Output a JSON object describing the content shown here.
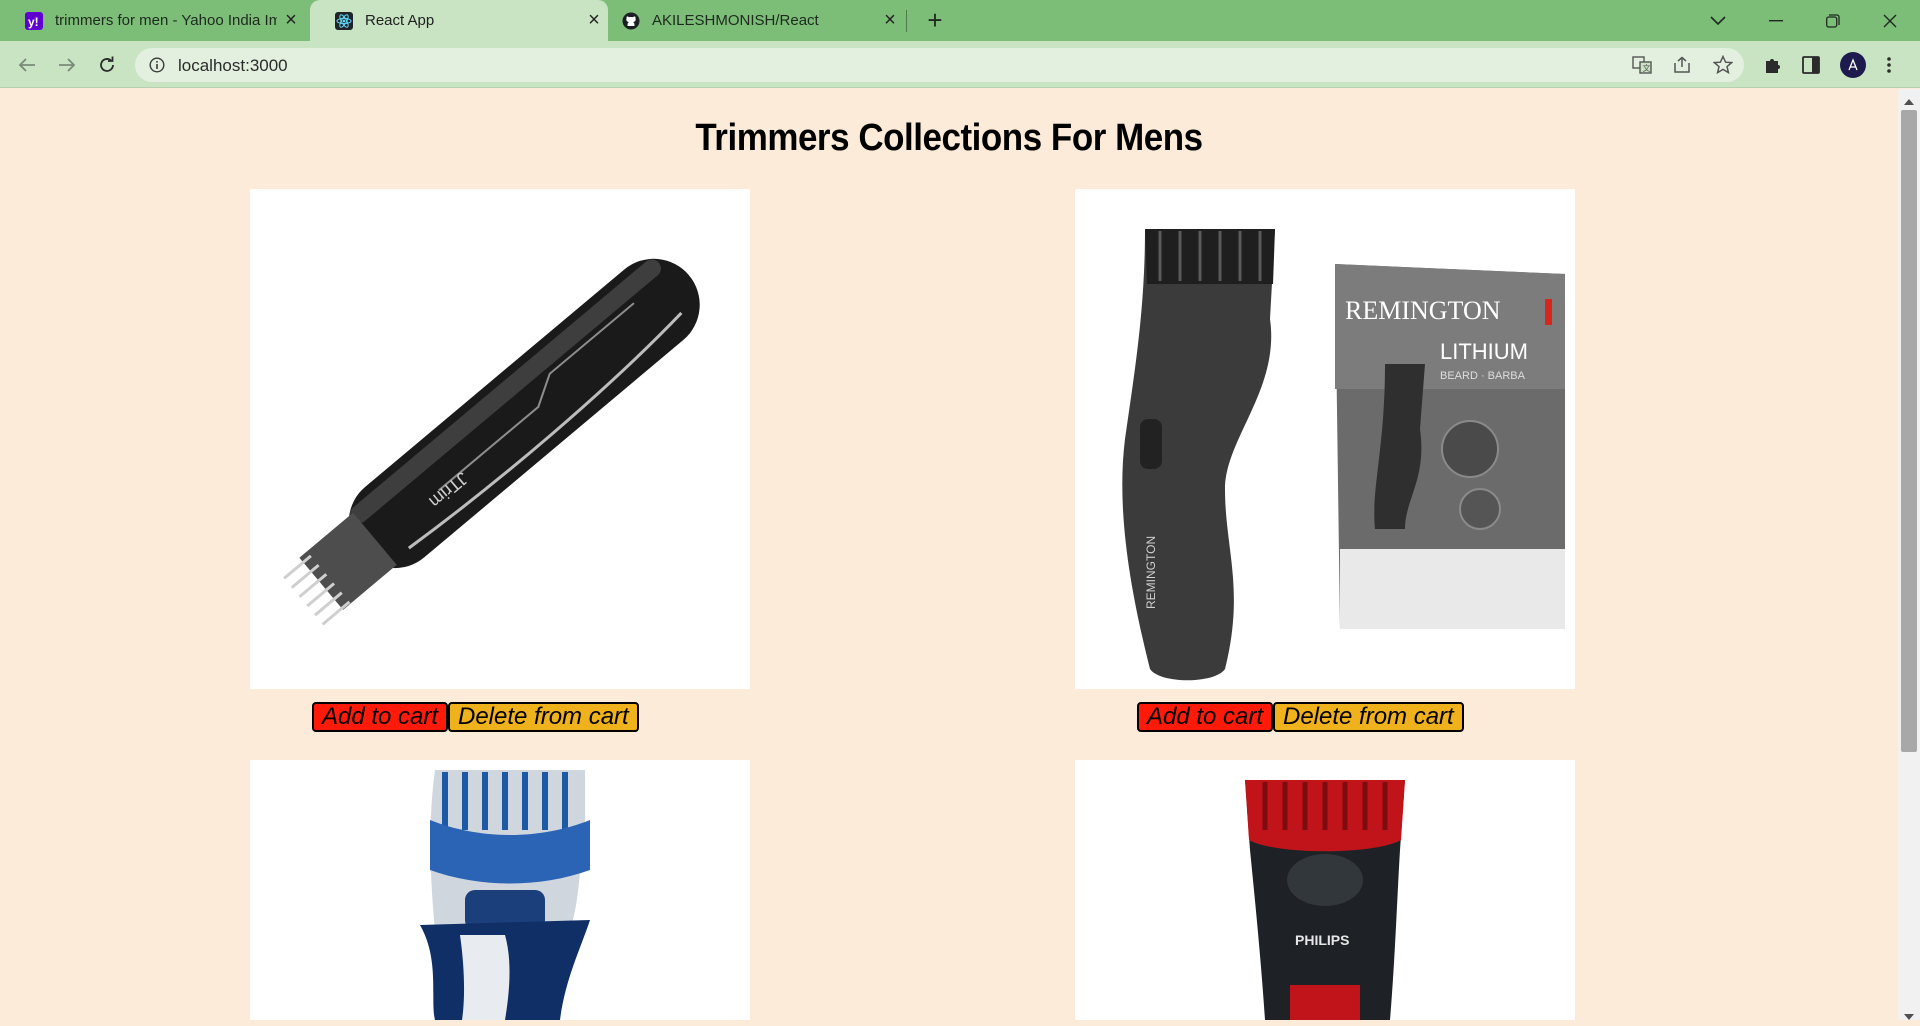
{
  "browser": {
    "tabs": [
      {
        "title": "trimmers for men - Yahoo India Image Search Results",
        "active": false,
        "favicon": "yahoo-icon"
      },
      {
        "title": "React App",
        "active": true,
        "favicon": "react-icon"
      },
      {
        "title": "AKILESHMONISH/React",
        "active": false,
        "favicon": "github-icon"
      }
    ],
    "url": "localhost:3000",
    "colors": {
      "tab_strip": "#7cbd78",
      "toolbar": "#c9e4c3",
      "page_bg": "#fbebd8",
      "avatar": "#1d1b4d"
    }
  },
  "page": {
    "title": "Trimmers Collections For Mens",
    "products": [
      {
        "name": "JTrim black trimmer",
        "add_label": "Add to cart",
        "delete_label": "Delete from cart"
      },
      {
        "name": "Remington Lithium beard trimmer",
        "box_brand": "REMINGTON",
        "box_line": "LITHIUM",
        "box_sub": "BEARD · BARBA",
        "add_label": "Add to cart",
        "delete_label": "Delete from cart"
      },
      {
        "name": "Blue and silver trimmer"
      },
      {
        "name": "Philips red trimmer",
        "brand": "PHILIPS"
      }
    ],
    "button_colors": {
      "add": "#ff1a0a",
      "delete": "#efb21c"
    }
  }
}
